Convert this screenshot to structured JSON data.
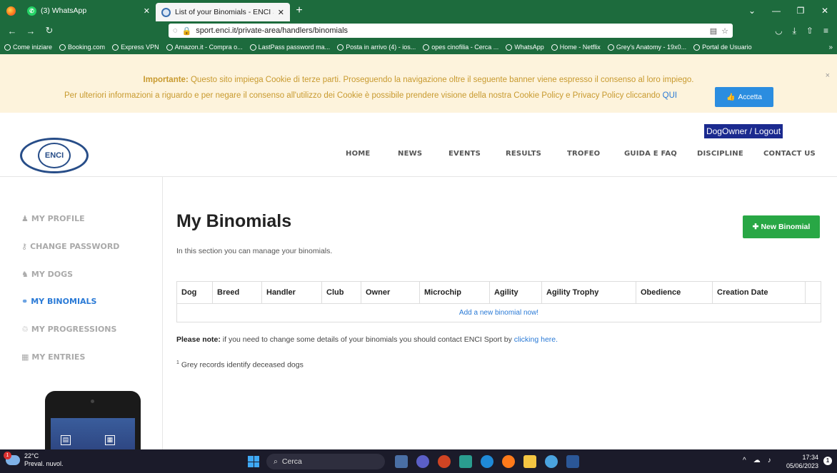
{
  "browser": {
    "tabs": [
      {
        "title": "(3) WhatsApp",
        "active": false
      },
      {
        "title": "List of your Binomials - ENCI Sp",
        "active": true
      }
    ],
    "new_tab": "+",
    "url": "sport.enci.it/private-area/handlers/binomials",
    "bookmarks": [
      "Come iniziare",
      "Booking.com",
      "Express VPN",
      "Amazon.it - Compra o...",
      "LastPass password ma...",
      "Posta in arrivo (4) - ios...",
      "opes cinofilia - Cerca ...",
      "WhatsApp",
      "Home - Netflix",
      "Grey's Anatomy - 19x0...",
      "Portal de Usuario"
    ]
  },
  "cookie_banner": {
    "strong": "Importante:",
    "line1": " Questo sito impiega Cookie di terze parti. Proseguendo la navigazione oltre il seguente banner viene espresso il consenso al loro impiego.",
    "line2": "Per ulteriori informazioni a riguardo e per negare il consenso all'utilizzo dei Cookie è possibile prendere visione della nostra Cookie Policy e Privacy Policy cliccando ",
    "link": "QUI",
    "accept": "Accetta",
    "close": "×"
  },
  "header": {
    "logo_text": "ENCI",
    "account": "DogOwner / Logout",
    "nav": [
      "HOME",
      "NEWS",
      "EVENTS",
      "RESULTS",
      "TROFEO",
      "GUIDA E FAQ",
      "DISCIPLINE",
      "CONTACT US"
    ]
  },
  "sidebar": {
    "items": [
      {
        "label": "MY PROFILE",
        "icon": "user-icon"
      },
      {
        "label": "CHANGE PASSWORD",
        "icon": "key-icon"
      },
      {
        "label": "MY DOGS",
        "icon": "dog-icon"
      },
      {
        "label": "MY BINOMIALS",
        "icon": "link-icon"
      },
      {
        "label": "MY PROGRESSIONS",
        "icon": "recycle-icon"
      },
      {
        "label": "MY ENTRIES",
        "icon": "calendar-icon"
      }
    ],
    "active": "MY BINOMIALS"
  },
  "main": {
    "title": "My Binomials",
    "subtitle": "In this section you can manage your binomials.",
    "new_button": "New Binomial",
    "columns": [
      "Dog",
      "Breed",
      "Handler",
      "Club",
      "Owner",
      "Microchip",
      "Agility",
      "Agility Trophy",
      "Obedience",
      "Creation Date",
      ""
    ],
    "empty_link": "Add a new binomial now!",
    "note_strong": "Please note:",
    "note_text": " if you need to change some details of your binomials you should contact ENCI Sport by ",
    "note_link": "clicking here.",
    "footnote_mark": "1",
    "footnote": " Grey records identify deceased dogs"
  },
  "taskbar": {
    "temperature": "22°C",
    "weather": "Preval. nuvol.",
    "badge": "1",
    "search": "Cerca",
    "time": "17:34",
    "date": "05/06/2023",
    "notif": "1"
  },
  "colors": {
    "browser_green": "#1d6b3d",
    "link_blue": "#2a7ad6",
    "new_button_green": "#28a745",
    "account_navy": "#1b2a8f",
    "cookie_bg": "#fdf3dc"
  }
}
